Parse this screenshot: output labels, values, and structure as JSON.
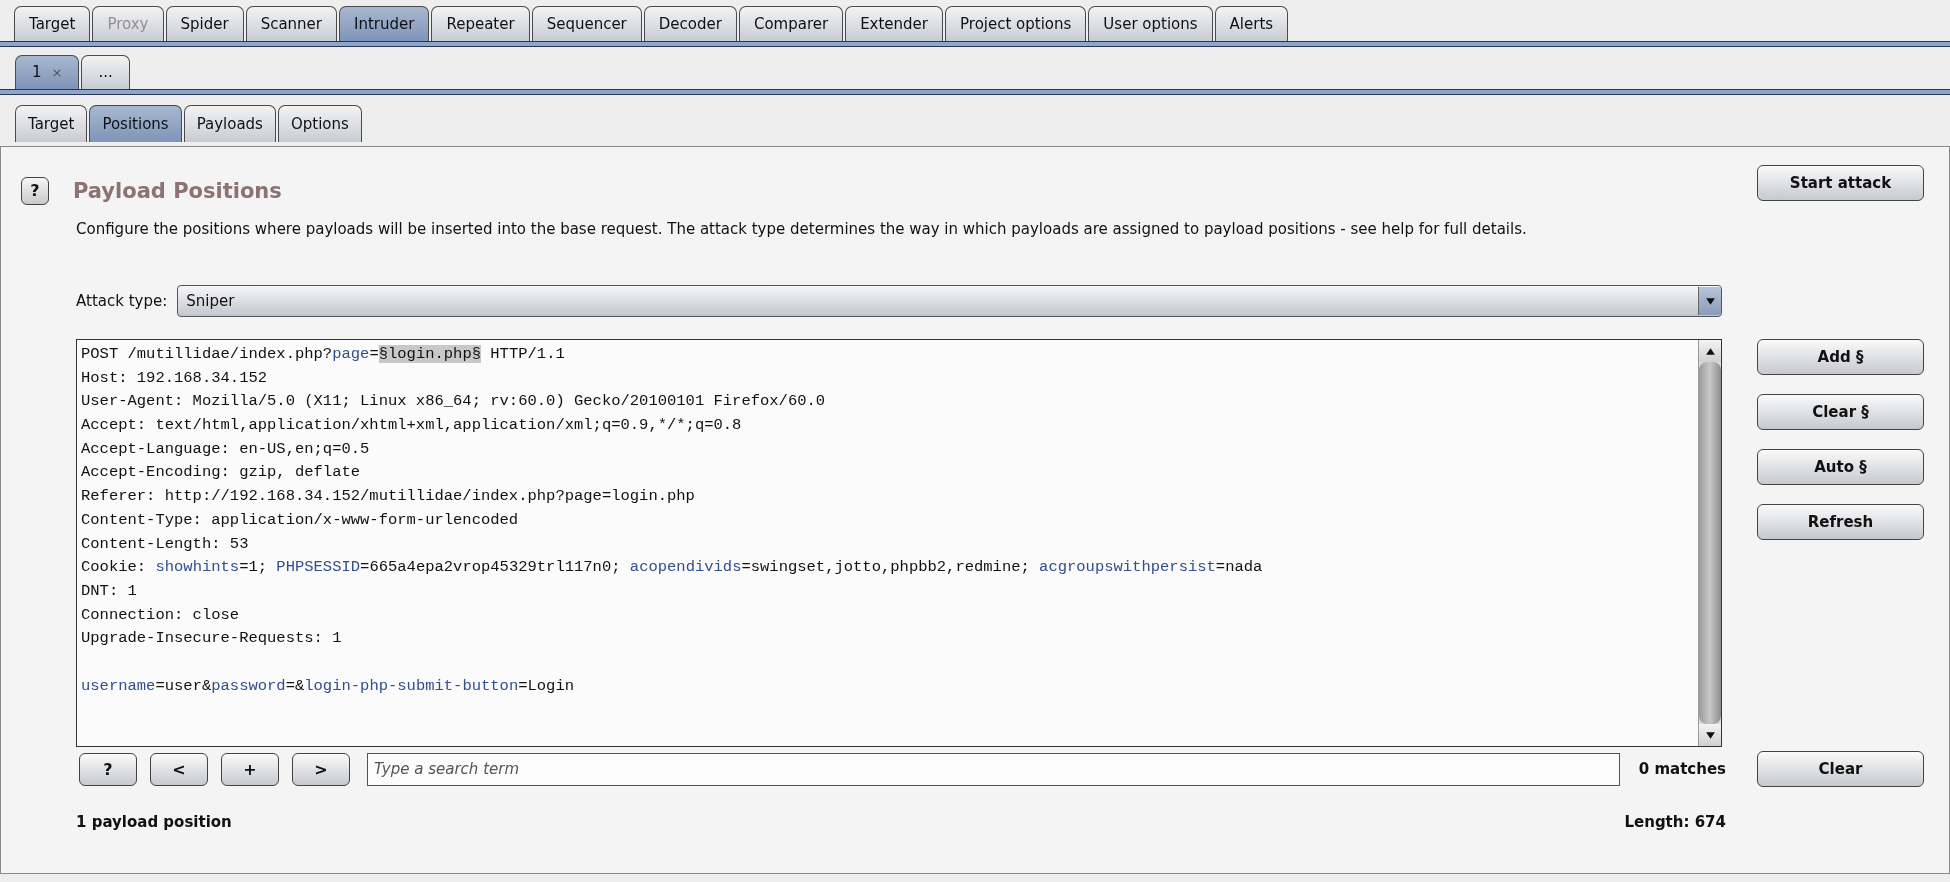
{
  "main_tabs": [
    {
      "label": "Target",
      "selected": false,
      "disabled": false
    },
    {
      "label": "Proxy",
      "selected": false,
      "disabled": true
    },
    {
      "label": "Spider",
      "selected": false,
      "disabled": false
    },
    {
      "label": "Scanner",
      "selected": false,
      "disabled": false
    },
    {
      "label": "Intruder",
      "selected": true,
      "disabled": false
    },
    {
      "label": "Repeater",
      "selected": false,
      "disabled": false
    },
    {
      "label": "Sequencer",
      "selected": false,
      "disabled": false
    },
    {
      "label": "Decoder",
      "selected": false,
      "disabled": false
    },
    {
      "label": "Comparer",
      "selected": false,
      "disabled": false
    },
    {
      "label": "Extender",
      "selected": false,
      "disabled": false
    },
    {
      "label": "Project options",
      "selected": false,
      "disabled": false
    },
    {
      "label": "User options",
      "selected": false,
      "disabled": false
    },
    {
      "label": "Alerts",
      "selected": false,
      "disabled": false
    }
  ],
  "attack_tabs": [
    {
      "label": "1",
      "close": "×",
      "selected": true
    },
    {
      "label": "...",
      "selected": false
    }
  ],
  "sub_tabs": [
    {
      "label": "Target",
      "selected": false
    },
    {
      "label": "Positions",
      "selected": true
    },
    {
      "label": "Payloads",
      "selected": false
    },
    {
      "label": "Options",
      "selected": false
    }
  ],
  "section": {
    "help": "?",
    "title": "Payload Positions",
    "description": "Configure the positions where payloads will be inserted into the base request. The attack type determines the way in which payloads are assigned to payload positions - see help for full details.",
    "attack_type_label": "Attack type:",
    "attack_type": "Sniper"
  },
  "start_button": "Start attack",
  "side_buttons": [
    "Add §",
    "Clear §",
    "Auto §",
    "Refresh"
  ],
  "request": {
    "lines": [
      {
        "kind": "text",
        "segments": [
          {
            "kind": "plain",
            "text": "POST /mutillidae/index.php?"
          },
          {
            "kind": "param",
            "text": "page"
          },
          {
            "kind": "plain",
            "text": "="
          },
          {
            "kind": "marker",
            "text": "§login.php§"
          },
          {
            "kind": "plain",
            "text": " HTTP/1.1"
          }
        ]
      },
      {
        "kind": "text",
        "segments": [
          {
            "kind": "plain",
            "text": "Host: 192.168.34.152"
          }
        ]
      },
      {
        "kind": "text",
        "segments": [
          {
            "kind": "plain",
            "text": "User-Agent: Mozilla/5.0 (X11; Linux x86_64; rv:60.0) Gecko/20100101 Firefox/60.0"
          }
        ]
      },
      {
        "kind": "text",
        "segments": [
          {
            "kind": "plain",
            "text": "Accept: text/html,application/xhtml+xml,application/xml;q=0.9,*/*;q=0.8"
          }
        ]
      },
      {
        "kind": "text",
        "segments": [
          {
            "kind": "plain",
            "text": "Accept-Language: en-US,en;q=0.5"
          }
        ]
      },
      {
        "kind": "text",
        "segments": [
          {
            "kind": "plain",
            "text": "Accept-Encoding: gzip, deflate"
          }
        ]
      },
      {
        "kind": "text",
        "segments": [
          {
            "kind": "plain",
            "text": "Referer: http://192.168.34.152/mutillidae/index.php?page=login.php"
          }
        ]
      },
      {
        "kind": "text",
        "segments": [
          {
            "kind": "plain",
            "text": "Content-Type: application/x-www-form-urlencoded"
          }
        ]
      },
      {
        "kind": "text",
        "segments": [
          {
            "kind": "plain",
            "text": "Content-Length: 53"
          }
        ]
      },
      {
        "kind": "text",
        "segments": [
          {
            "kind": "plain",
            "text": "Cookie: "
          },
          {
            "kind": "param",
            "text": "showhints"
          },
          {
            "kind": "plain",
            "text": "=1; "
          },
          {
            "kind": "param",
            "text": "PHPSESSID"
          },
          {
            "kind": "plain",
            "text": "=665a4epa2vrop45329trl117n0; "
          },
          {
            "kind": "param",
            "text": "acopendivids"
          },
          {
            "kind": "plain",
            "text": "=swingset,jotto,phpbb2,redmine; "
          },
          {
            "kind": "param",
            "text": "acgroupswithpersist"
          },
          {
            "kind": "plain",
            "text": "=nada"
          }
        ]
      },
      {
        "kind": "text",
        "segments": [
          {
            "kind": "plain",
            "text": "DNT: 1"
          }
        ]
      },
      {
        "kind": "text",
        "segments": [
          {
            "kind": "plain",
            "text": "Connection: close"
          }
        ]
      },
      {
        "kind": "text",
        "segments": [
          {
            "kind": "plain",
            "text": "Upgrade-Insecure-Requests: 1"
          }
        ]
      },
      {
        "kind": "blank"
      },
      {
        "kind": "text",
        "segments": [
          {
            "kind": "param",
            "text": "username"
          },
          {
            "kind": "plain",
            "text": "=user&"
          },
          {
            "kind": "param",
            "text": "password"
          },
          {
            "kind": "plain",
            "text": "=&"
          },
          {
            "kind": "param",
            "text": "login-php-submit-button"
          },
          {
            "kind": "plain",
            "text": "=Login"
          }
        ]
      }
    ]
  },
  "search": {
    "buttons": [
      "?",
      "<",
      "+",
      ">"
    ],
    "placeholder": "Type a search term",
    "matches": "0 matches",
    "clear": "Clear"
  },
  "footer": {
    "positions": "1 payload position",
    "length": "Length: 674"
  }
}
